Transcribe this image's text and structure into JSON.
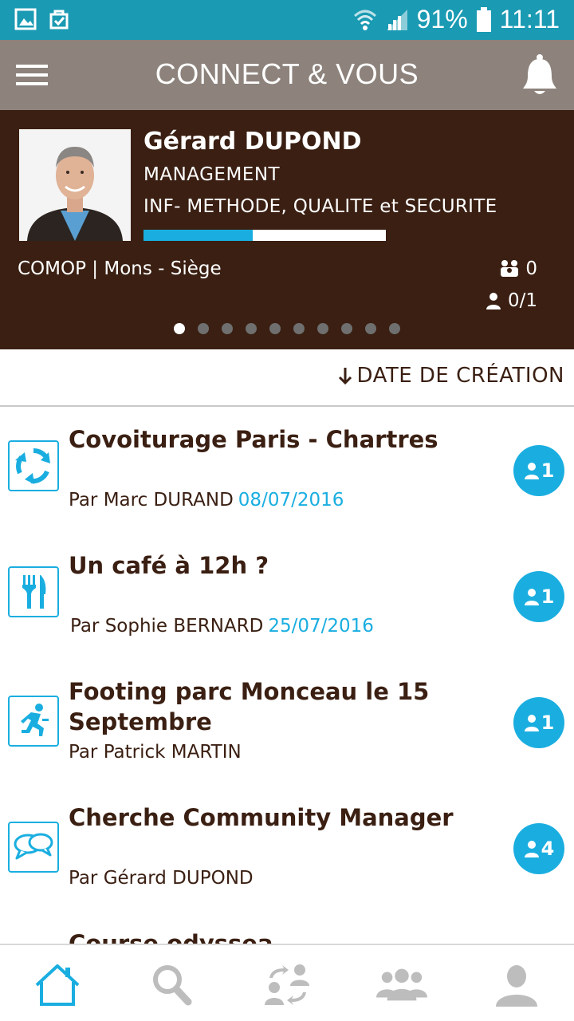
{
  "status_bar": {
    "battery": "91%",
    "time": "11:11",
    "icons": [
      "gallery-icon",
      "store-icon",
      "wifi-icon",
      "signal-icon",
      "battery-icon"
    ]
  },
  "app_bar": {
    "title": "CONNECT & VOUS",
    "icons": [
      "menu-icon",
      "bell-icon"
    ]
  },
  "profile": {
    "name": "Gérard DUPOND",
    "department": "MANAGEMENT",
    "service": "INF- METHODE, QUALITE et SECURITE",
    "progress": 0.45,
    "location": "COMOP | Mons - Siège",
    "groups_count": "0",
    "participation": "0/1",
    "page_dots": 10,
    "active_dot": 0
  },
  "sort": {
    "label": "DATE DE CRÉATION",
    "icon": "arrow-down-icon"
  },
  "items": [
    {
      "title": "Covoiturage Paris - Chartres",
      "author": "Par Marc DURAND",
      "date": "08/07/2016",
      "count": "1",
      "icon": "carpool-icon"
    },
    {
      "title": "Un café à 12h ?",
      "author": "Par Sophie BERNARD",
      "date": "25/07/2016",
      "count": "1",
      "icon": "cutlery-icon"
    },
    {
      "title": "Footing parc Monceau le 15 Septembre",
      "author": "Par Patrick MARTIN",
      "date": "",
      "count": "1",
      "icon": "running-icon"
    },
    {
      "title": "Cherche Community Manager",
      "author": "Par Gérard DUPOND",
      "date": "",
      "count": "4",
      "icon": "chat-icon"
    },
    {
      "title": "Course odyssea",
      "author": "",
      "date": "",
      "count": "",
      "icon": ""
    }
  ],
  "bottom_nav": [
    {
      "name": "home",
      "icon": "home-icon",
      "active": true
    },
    {
      "name": "search",
      "icon": "search-icon",
      "active": false
    },
    {
      "name": "exchange",
      "icon": "exchange-icon",
      "active": false
    },
    {
      "name": "groups",
      "icon": "group-icon",
      "active": false
    },
    {
      "name": "profile",
      "icon": "user-icon",
      "active": false
    }
  ],
  "colors": {
    "status_bar": "#1a9ab3",
    "app_bar": "#8d837c",
    "profile_bg": "#3a1f12",
    "accent": "#1aaee0",
    "text_dark": "#3a1f12",
    "nav_inactive": "#bdbdbd"
  }
}
